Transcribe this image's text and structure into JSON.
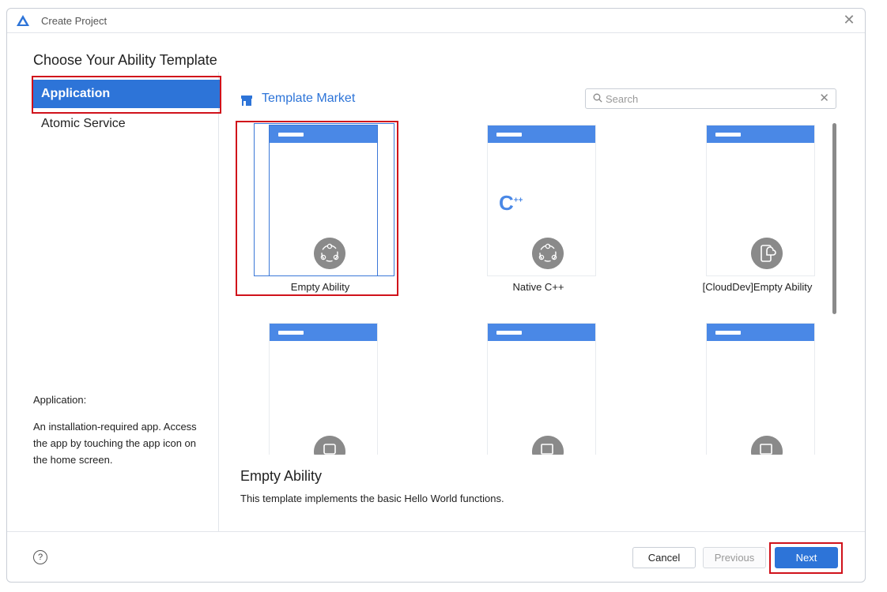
{
  "window": {
    "title": "Create Project",
    "logo_icon": "deveco-logo-icon",
    "close_icon": "close-icon"
  },
  "page": {
    "title": "Choose Your Ability Template"
  },
  "sidebar": {
    "items": [
      {
        "label": "Application",
        "active": true
      },
      {
        "label": "Atomic Service",
        "active": false
      }
    ],
    "description_title": "Application:",
    "description_text": "An installation-required app. Access the app by touching the app icon on the home screen."
  },
  "market": {
    "label": "Template Market",
    "icon": "store-icon"
  },
  "search": {
    "placeholder": "Search",
    "value": "",
    "icon": "search-icon",
    "clear_icon": "clear-icon"
  },
  "templates": [
    {
      "label": "Empty Ability",
      "selected": true,
      "badge_icon": "ability-circle-icon"
    },
    {
      "label": "Native C++",
      "selected": false,
      "badge_icon": "ability-circle-icon",
      "center_text": "C++"
    },
    {
      "label": "[CloudDev]Empty Ability",
      "selected": false,
      "badge_icon": "cloud-device-icon"
    },
    {
      "label": "",
      "selected": false,
      "badge_icon": "template-icon"
    },
    {
      "label": "",
      "selected": false,
      "badge_icon": "template-icon"
    },
    {
      "label": "",
      "selected": false,
      "badge_icon": "template-icon"
    }
  ],
  "selected_template": {
    "name": "Empty Ability",
    "description": "This template implements the basic Hello World functions."
  },
  "footer": {
    "help_icon": "help-icon",
    "help_glyph": "?",
    "cancel_label": "Cancel",
    "previous_label": "Previous",
    "next_label": "Next"
  },
  "colors": {
    "accent": "#2d74d8",
    "card_header": "#4a88e6",
    "highlight": "#d0121b",
    "badge": "#8a8a8a"
  }
}
